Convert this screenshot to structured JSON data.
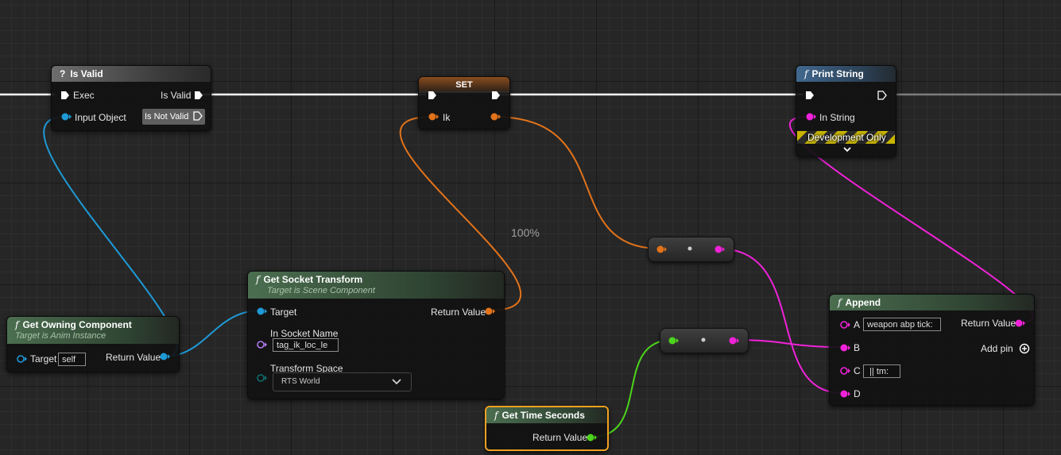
{
  "zoom_label": "100%",
  "colors": {
    "exec": "#ffffff",
    "object": "#1e9ad6",
    "struct": "#e2731a",
    "string": "#f022d9",
    "float": "#4cd41c",
    "name": "#b07bf0",
    "enum": "#0d6e6e"
  },
  "is_valid_node": {
    "title": "Is Valid",
    "icon": "question-icon",
    "exec_label": "Exec",
    "is_valid_label": "Is Valid",
    "input_object_label": "Input Object",
    "is_not_valid_label": "Is Not Valid"
  },
  "set_node": {
    "title": "SET",
    "var_label": "Ik"
  },
  "print_string_node": {
    "title": "Print String",
    "in_string_label": "In String",
    "dev_only_label": "Development Only"
  },
  "get_owning_component_node": {
    "title": "Get Owning Component",
    "subtitle": "Target is Anim Instance",
    "target_label": "Target",
    "target_value": "self",
    "return_label": "Return Value"
  },
  "get_socket_transform_node": {
    "title": "Get Socket Transform",
    "subtitle": "Target is Scene Component",
    "target_label": "Target",
    "return_label": "Return Value",
    "socket_name_label": "In Socket Name",
    "socket_name_value": "tag_ik_loc_le",
    "transform_space_label": "Transform Space",
    "transform_space_value": "RTS World"
  },
  "append_node": {
    "title": "Append",
    "pin_a_label": "A",
    "pin_a_value": "weapon abp tick:",
    "return_label": "Return Value",
    "pin_b_label": "B",
    "add_pin_label": "Add pin",
    "pin_c_label": "C",
    "pin_c_value": " || tm:",
    "pin_d_label": "D"
  },
  "get_time_seconds_node": {
    "title": "Get Time Seconds",
    "return_label": "Return Value"
  }
}
